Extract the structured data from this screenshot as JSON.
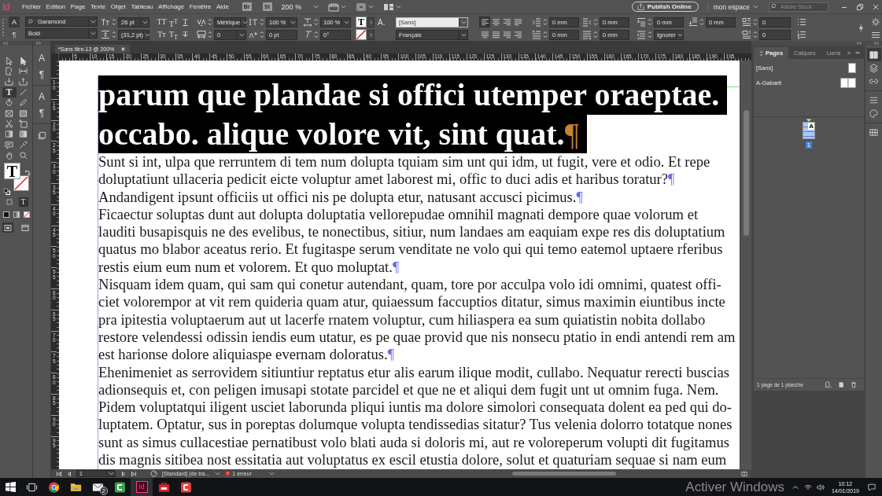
{
  "menu_bar": {
    "logo": "Id",
    "menus": [
      "Fichier",
      "Edition",
      "Page",
      "Texte",
      "Objet",
      "Tableau",
      "Affichage",
      "Fenêtre",
      "Aide"
    ],
    "bridge": "Br",
    "stock": "St",
    "zoom": "200 %",
    "publish_button": "Publish Online",
    "workspace": "mon espace",
    "search_placeholder": "Adobe Stock"
  },
  "control_panel": {
    "modes": [
      {
        "label": "A",
        "selected": true
      },
      {
        "label": "¶",
        "selected": false
      }
    ],
    "font_family": "Garamond",
    "font_style": "Bold",
    "font_size": "26 pt",
    "leading": "(31,2 pt)",
    "case_buttons": [
      {
        "label": "TT",
        "kind": "plain"
      },
      {
        "label": "T$^{T}$",
        "kind": "plain"
      },
      {
        "label": "T",
        "kind": "underline"
      },
      {
        "label": "Tᴛ",
        "kind": "plain"
      },
      {
        "label": "T$_{T}$",
        "kind": "plain"
      },
      {
        "label": "T",
        "kind": "strike"
      }
    ],
    "kerning": "Métrique",
    "tracking": "0",
    "vertical_scale": "100 %",
    "baseline_shift": "0 pt",
    "horizontal_scale": "100 %",
    "skew": "0°",
    "fill_letter": "T",
    "style_letter": "A.",
    "character_style": "[Sans]",
    "language": "Français",
    "align_buttons": [
      {
        "kind": "left",
        "selected": true
      },
      {
        "kind": "center",
        "selected": false
      },
      {
        "kind": "right",
        "selected": false
      },
      {
        "kind": "justify-left",
        "selected": false
      },
      {
        "kind": "justify-center",
        "selected": false
      },
      {
        "kind": "justify-all",
        "selected": false
      },
      {
        "kind": "justify-right",
        "selected": false
      },
      {
        "kind": "right",
        "selected": false
      }
    ],
    "indents": [
      "0 mm",
      "0 mm",
      "0 mm",
      "0 mm",
      "0 mm",
      "0 mm"
    ],
    "grid_alignment": "Ignorer",
    "drop_cap_lines": "0",
    "drop_cap_characters": "0"
  },
  "tools": [
    {
      "kind": "selection",
      "selected": false
    },
    {
      "kind": "direct-selection",
      "selected": false
    },
    {
      "kind": "page",
      "selected": false
    },
    {
      "kind": "gap",
      "selected": false
    },
    {
      "kind": "collector",
      "selected": false
    },
    {
      "kind": "placer",
      "selected": false
    },
    {
      "kind": "type",
      "glyph": "T",
      "selected": true
    },
    {
      "kind": "line",
      "selected": false
    },
    {
      "kind": "pen",
      "selected": false
    },
    {
      "kind": "pencil",
      "selected": false
    },
    {
      "kind": "frame",
      "selected": false
    },
    {
      "kind": "rectangle",
      "selected": false
    },
    {
      "kind": "scissors",
      "selected": false
    },
    {
      "kind": "transform",
      "selected": false
    },
    {
      "kind": "gradient",
      "selected": false
    },
    {
      "kind": "gradient-feather",
      "selected": false
    },
    {
      "kind": "note",
      "selected": false
    },
    {
      "kind": "eyedropper",
      "selected": false
    },
    {
      "kind": "hand",
      "selected": false
    },
    {
      "kind": "zoom",
      "selected": false
    }
  ],
  "fill_stroke": {
    "fill_letter": "T",
    "format_targets": [
      {
        "kind": "container",
        "selected": false
      },
      {
        "kind": "text",
        "label": "T",
        "selected": true
      }
    ],
    "apply": [
      {
        "kind": "color"
      },
      {
        "kind": "gradient"
      },
      {
        "kind": "none"
      }
    ],
    "view_modes": [
      {
        "kind": "normal",
        "selected": true
      },
      {
        "kind": "screen",
        "selected": false
      }
    ]
  },
  "style_panels": [
    {
      "kind": "character",
      "glyph": "A"
    },
    {
      "kind": "paragraph",
      "glyph": "¶"
    },
    {
      "kind": "character-source",
      "glyph": "A"
    },
    {
      "kind": "paragraph-source",
      "glyph": "¶"
    },
    {
      "kind": "object"
    }
  ],
  "document": {
    "tab": "*Sans titre-13 @ 200%",
    "ruler_h": [
      "5",
      "10",
      "15",
      "20",
      "25",
      "30",
      "35",
      "40",
      "45",
      "50",
      "55",
      "60",
      "65",
      "70",
      "75",
      "80",
      "85",
      "90",
      "95",
      "100",
      "105",
      "110",
      "115",
      "120",
      "125",
      "130",
      "135",
      "140",
      "145",
      "150",
      "155",
      "160",
      "165",
      "170",
      "175",
      "180",
      "185",
      "190",
      "195"
    ],
    "ruler_v": [
      "10",
      "15",
      "20",
      "25",
      "30",
      "35",
      "40",
      "45",
      "50",
      "55",
      "60",
      "65",
      "70",
      "75",
      "80",
      "85",
      "90",
      "95"
    ],
    "heading": {
      "lines": [
        "parum que plandae si offici utemper oraeptae.",
        "occabo. alique volore vit, sint quat."
      ],
      "end_mark": "¶",
      "selected": true
    },
    "paragraphs": [
      {
        "lines": [
          "Sunt si int, ulpa que rerruntem di tem num dolupta tquiam sim unt qui idm, ut fugit, vere et odio. Et repe",
          "doluptatiunt ullaceria pedicit eicte voluptur amet laborest mi, offic to duci adis et haribus toratur?"
        ],
        "end_mark": "¶"
      },
      {
        "lines": [
          "Andandigent ipsunt officiis ut offici nis pe dolupta etur, natusant accusci picimus."
        ],
        "end_mark": "¶"
      },
      {
        "lines": [
          "Ficaectur soluptas dunt aut dolupta doluptatia vellorepudae omnihil magnati dempore quae volorum et",
          "lauditi busapisquis ne des evelibus, te nonectibus, sitiur, num landaes am eaquiam expe res dis doluptatium",
          "quatus mo blabor aceatus rerio. Et fugitaspe serum venditate ne volo qui qui temo eatemol uptaere rferibus",
          "restis eium eum num et volorem. Et quo moluptat."
        ],
        "end_mark": "¶"
      },
      {
        "lines": [
          "Nisquam idem quam, qui sam qui conetur autendant, quam, tore por acculpa volo idi omnimi, quatest offi-",
          "ciet volorempor at vit rem quideria quam atur, quiaessum faccuptios ditatur, simus maximin eiuntibus incte",
          "pra ipitestia voluptaerum aut ut lacerfe rnatem voluptur, cum hiliaspera ea sum quiatistin nobita dollabo",
          "restore velendessi odissin iendis eum utatur, es pe quae provid que nis nonsecu ptatio in endi antendi rem am",
          "est harionse dolore aliquiaspe evernam doloratus."
        ],
        "end_mark": "¶"
      },
      {
        "lines": [
          "Ehenimeniet as serrovidem sitiuntiur reptatus etur alis earum ilique modit, cullabo. Nequatur rerecti buscias",
          "adionsequis et, con peligen imusapi stotate parcidel et que ne et aliqui dem fugit unt ut omnim fuga. Nem.",
          "Pidem voluptatqui iligent usciet laborunda pliqui iuntis ma dolore simolori consequata dolent ea ped qui do-",
          "luptatem. Optatur, sus in poreptas dolumque volupta tendissedias sitatur? Tus velenia dolorro totatque nones",
          "sunt as simus cullacestiae pernatibust volo blati auda si doloris mi, aut re voloreperum volupti dit fugitamus",
          "dis magnis sitibea nost essitatia aut voluptatus ex escil etustia dolore, solut et quaturiam sequae si nam eum"
        ]
      }
    ]
  },
  "pages_panel": {
    "tabs": [
      {
        "label": "Pages",
        "selected": true
      },
      {
        "label": "Calques",
        "selected": false
      },
      {
        "label": "Liens",
        "selected": false
      }
    ],
    "masters": [
      {
        "label": "[Sans]",
        "kind": "single"
      },
      {
        "label": "A-Gabarit",
        "kind": "spread"
      }
    ],
    "pages": [
      {
        "master": "A",
        "number": "1",
        "selected": true
      }
    ],
    "footer": "1 page de 1 planche"
  },
  "dock_icons": [
    {
      "kind": "pages",
      "selected": true
    },
    {
      "kind": "layers",
      "selected": false
    },
    {
      "kind": "links",
      "selected": false
    },
    {
      "kind": "stroke",
      "selected": false
    },
    {
      "kind": "color",
      "selected": false
    },
    {
      "kind": "swatches",
      "selected": false
    }
  ],
  "status_bar": {
    "page": "1",
    "preflight_profile": "[Standard] (de tra...",
    "errors": "1 erreur"
  },
  "taskbar": {
    "apps": [
      {
        "kind": "task-view",
        "selected": false
      },
      {
        "kind": "circle-logo",
        "selected": false
      },
      {
        "kind": "folder",
        "selected": false
      },
      {
        "kind": "mail",
        "badge": "2",
        "selected": false
      },
      {
        "kind": "green-tile",
        "selected": false
      },
      {
        "kind": "lettered-tile",
        "label": "Id",
        "selected": true
      },
      {
        "kind": "red-tile",
        "selected": false
      },
      {
        "kind": "red-ring-tile",
        "selected": false
      }
    ],
    "activation_notice": "Activer Windows",
    "time": "10:12",
    "date": "14/01/2019"
  }
}
